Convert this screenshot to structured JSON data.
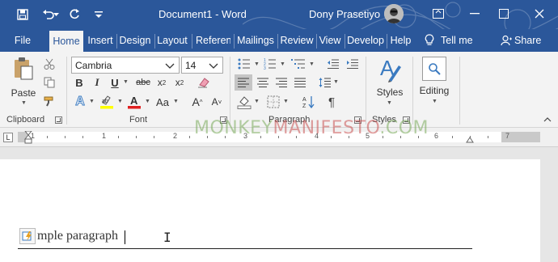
{
  "titlebar": {
    "doc_title": "Document1  -  Word",
    "user_name": "Dony Prasetiyo"
  },
  "tabs": [
    {
      "label": "File"
    },
    {
      "label": "Home"
    },
    {
      "label": "Insert"
    },
    {
      "label": "Design"
    },
    {
      "label": "Layout"
    },
    {
      "label": "Referen"
    },
    {
      "label": "Mailings"
    },
    {
      "label": "Review"
    },
    {
      "label": "View"
    },
    {
      "label": "Develop"
    },
    {
      "label": "Help"
    },
    {
      "label": "Tell me"
    },
    {
      "label": "Share"
    }
  ],
  "active_tab": "Home",
  "ribbon": {
    "clipboard": {
      "label": "Clipboard",
      "paste": "Paste"
    },
    "font": {
      "label": "Font",
      "font_name": "Cambria",
      "font_size": "14"
    },
    "paragraph": {
      "label": "Paragraph"
    },
    "styles": {
      "label": "Styles",
      "button": "Styles"
    },
    "editing": {
      "button": "Editing"
    }
  },
  "ruler": {
    "numbers": [
      "1",
      "1",
      "2",
      "3",
      "4",
      "5",
      "6",
      "7"
    ]
  },
  "watermark": {
    "part1": "MONKEY",
    "part2": "MANIFESTO",
    "part3": ".COM"
  },
  "document": {
    "paragraph_text": "mple paragraph"
  },
  "colors": {
    "brand": "#2b579a",
    "ribbon_bg": "#f3f3f3",
    "highlight": "#ffff00",
    "font_color": "#e02020"
  }
}
